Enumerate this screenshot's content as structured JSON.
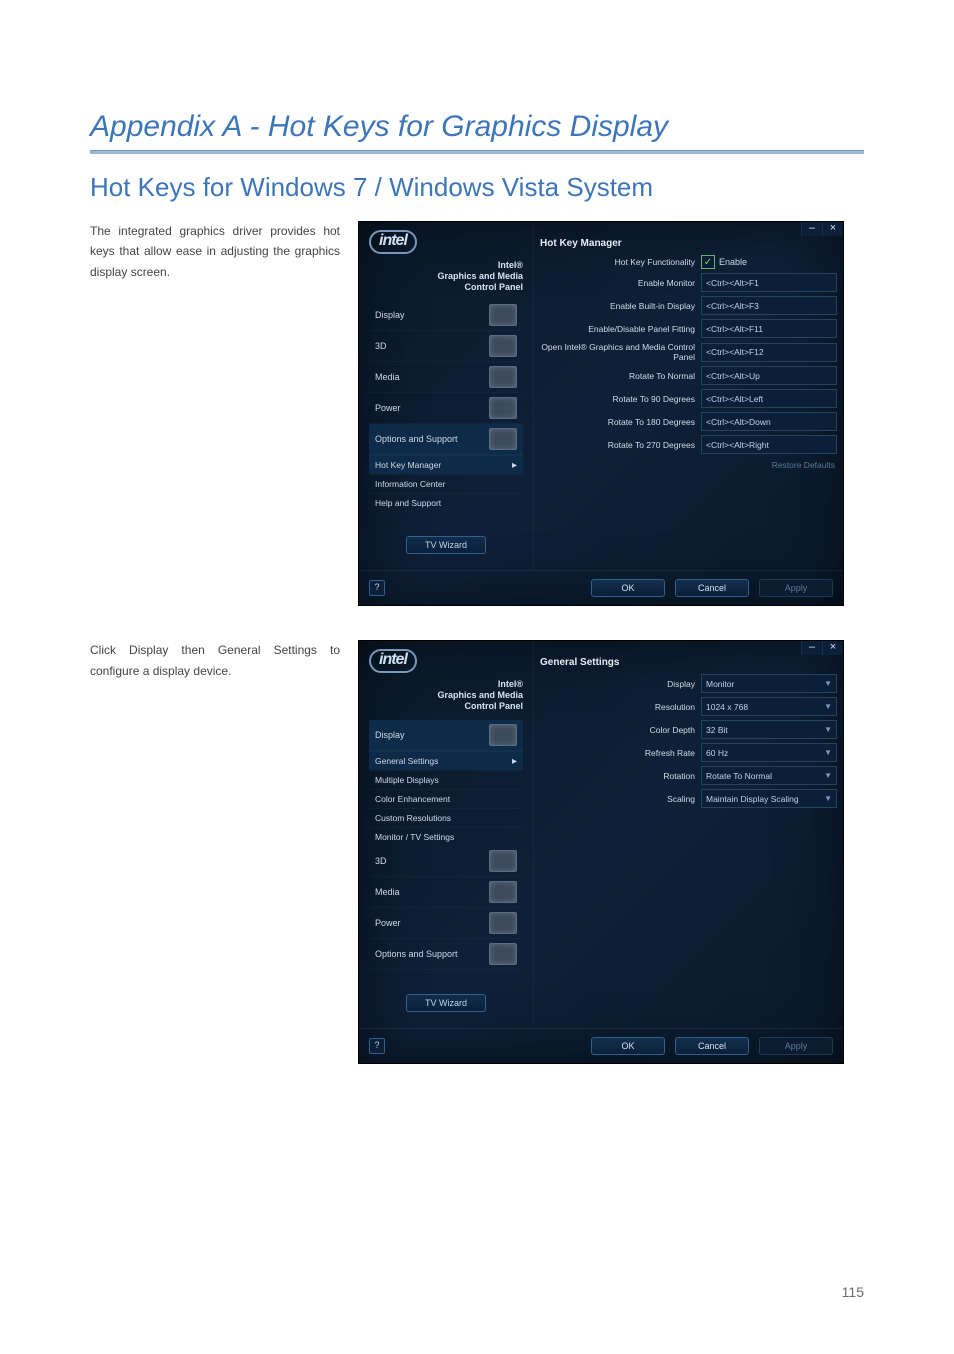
{
  "page_number": "115",
  "title": "Appendix A - Hot Keys for Graphics Display",
  "subtitle": "Hot Keys for Windows 7 / Windows Vista System",
  "para1": "The integrated graphics driver provides hot keys that allow ease in adjusting the graphics display screen.",
  "para2": "Click Display then General Settings to configure a display device.",
  "cp": {
    "logo": "intel",
    "brand_l1": "Intel®",
    "brand_l2": "Graphics and Media",
    "brand_l3": "Control Panel",
    "tv_wizard": "TV Wizard",
    "win_min": "–",
    "win_close": "×",
    "help_btn": "?",
    "ok": "OK",
    "cancel": "Cancel",
    "apply": "Apply"
  },
  "panel1": {
    "nav": [
      "Display",
      "3D",
      "Media",
      "Power",
      "Options and Support"
    ],
    "subnav": [
      "Hot Key Manager",
      "Information Center",
      "Help and Support"
    ],
    "header": "Hot Key Manager",
    "func_label": "Hot Key Functionality",
    "enable": "Enable",
    "rows": [
      {
        "label": "Enable Monitor",
        "value": "<Ctrl><Alt>F1"
      },
      {
        "label": "Enable Built-in Display",
        "value": "<Ctrl><Alt>F3"
      },
      {
        "label": "Enable/Disable Panel Fitting",
        "value": "<Ctrl><Alt>F11"
      },
      {
        "label": "Open Intel® Graphics and Media Control Panel",
        "value": "<Ctrl><Alt>F12"
      },
      {
        "label": "Rotate To Normal",
        "value": "<Ctrl><Alt>Up"
      },
      {
        "label": "Rotate To 90 Degrees",
        "value": "<Ctrl><Alt>Left"
      },
      {
        "label": "Rotate To 180 Degrees",
        "value": "<Ctrl><Alt>Down"
      },
      {
        "label": "Rotate To 270 Degrees",
        "value": "<Ctrl><Alt>Right"
      }
    ],
    "restore": "Restore Defaults"
  },
  "panel2": {
    "nav": [
      "Display"
    ],
    "subnav": [
      "General Settings",
      "Multiple Displays",
      "Color Enhancement",
      "Custom Resolutions",
      "Monitor / TV Settings"
    ],
    "nav2": [
      "3D",
      "Media",
      "Power",
      "Options and Support"
    ],
    "header": "General Settings",
    "rows": [
      {
        "label": "Display",
        "value": "Monitor"
      },
      {
        "label": "Resolution",
        "value": "1024 x 768"
      },
      {
        "label": "Color Depth",
        "value": "32 Bit"
      },
      {
        "label": "Refresh Rate",
        "value": "60 Hz"
      },
      {
        "label": "Rotation",
        "value": "Rotate To Normal"
      },
      {
        "label": "Scaling",
        "value": "Maintain Display Scaling"
      }
    ]
  }
}
